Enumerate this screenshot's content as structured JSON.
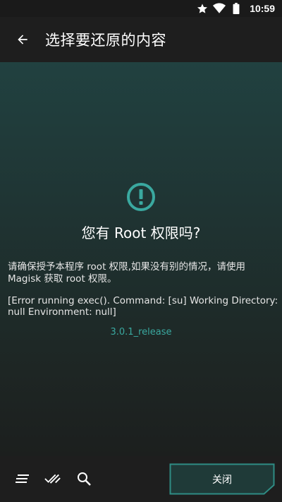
{
  "status_bar": {
    "time": "10:59",
    "icons": [
      "star-icon",
      "wifi-icon",
      "battery-icon"
    ]
  },
  "app_bar": {
    "title": "选择要还原的内容",
    "back_icon": "arrow-back-icon"
  },
  "dialog": {
    "icon": "alert-circle-icon",
    "heading": "您有 Root 权限吗?",
    "message": "请确保授予本程序 root 权限,如果没有别的情况，请使用 Magisk 获取 root 权限。",
    "error": "[Error running exec(). Command: [su] Working Directory: null Environment: null]",
    "version": "3.0.1_release"
  },
  "bottom_bar": {
    "icons": [
      "sort-lines-icon",
      "double-check-icon",
      "search-icon"
    ],
    "close_label": "关闭"
  },
  "colors": {
    "accent": "#3aa9a0",
    "background": "#1c1f1f",
    "bar": "#1e1e1e",
    "button_fill": "#1f3a38",
    "button_border": "#2f8c84"
  }
}
